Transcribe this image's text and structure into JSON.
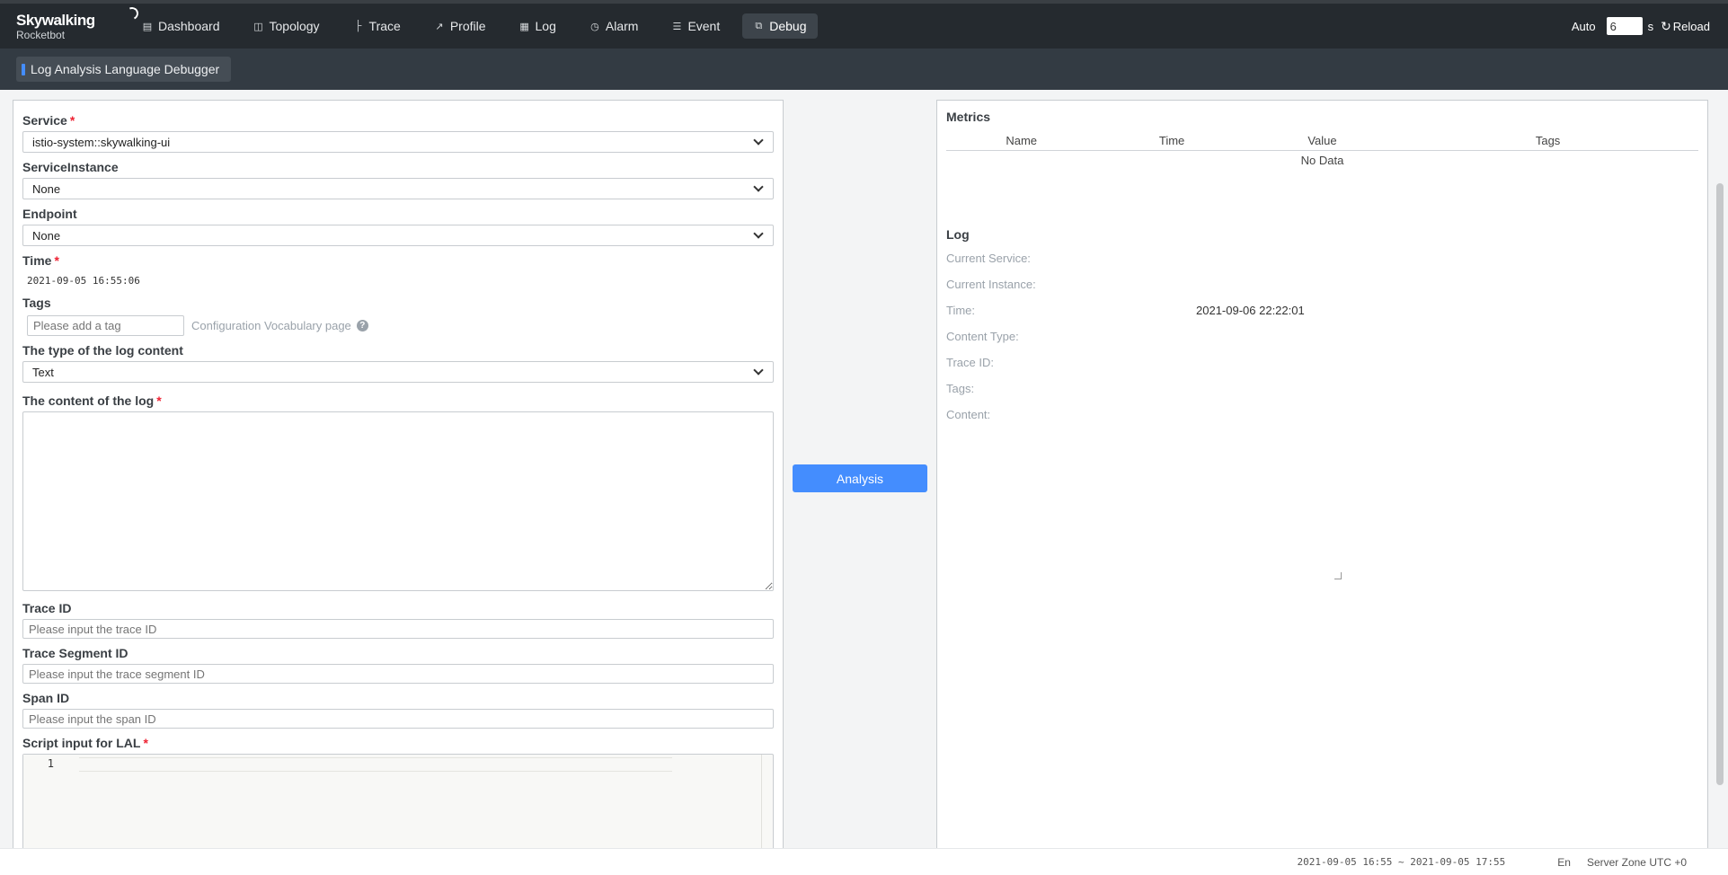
{
  "app": {
    "brand": "Skywalking",
    "sub": "Rocketbot"
  },
  "nav": {
    "items": [
      {
        "label": "Dashboard",
        "icon": "bar-chart-icon"
      },
      {
        "label": "Topology",
        "icon": "topology-icon"
      },
      {
        "label": "Trace",
        "icon": "trace-icon"
      },
      {
        "label": "Profile",
        "icon": "profile-icon"
      },
      {
        "label": "Log",
        "icon": "log-icon"
      },
      {
        "label": "Alarm",
        "icon": "alarm-icon"
      },
      {
        "label": "Event",
        "icon": "event-icon"
      },
      {
        "label": "Debug",
        "icon": "debug-icon",
        "active": true
      }
    ]
  },
  "topright": {
    "auto_label": "Auto",
    "interval_value": "6",
    "unit": "s",
    "reload_label": "Reload"
  },
  "page": {
    "tab_label": "Log Analysis Language Debugger"
  },
  "form": {
    "service_label": "Service",
    "service_value": "istio-system::skywalking-ui",
    "instance_label": "ServiceInstance",
    "instance_value": "None",
    "endpoint_label": "Endpoint",
    "endpoint_value": "None",
    "time_label": "Time",
    "time_value": "2021-09-05 16:55:06",
    "tags_label": "Tags",
    "tags_placeholder": "Please add a tag",
    "tags_link": "Configuration Vocabulary page",
    "content_type_label": "The type of the log content",
    "content_type_value": "Text",
    "content_label": "The content of the log",
    "trace_id_label": "Trace ID",
    "trace_id_placeholder": "Please input the trace ID",
    "segment_id_label": "Trace Segment ID",
    "segment_id_placeholder": "Please input the trace segment ID",
    "span_id_label": "Span ID",
    "span_id_placeholder": "Please input the span ID",
    "script_label": "Script input for LAL",
    "script_line_number": "1"
  },
  "actions": {
    "analysis_label": "Analysis"
  },
  "metrics": {
    "title": "Metrics",
    "columns": [
      "Name",
      "Time",
      "Value",
      "Tags"
    ],
    "empty": "No Data"
  },
  "log": {
    "title": "Log",
    "rows": [
      {
        "key": "Current Service:",
        "value": ""
      },
      {
        "key": "Current Instance:",
        "value": ""
      },
      {
        "key": "Time:",
        "value": "2021-09-06 22:22:01"
      },
      {
        "key": "Content Type:",
        "value": ""
      },
      {
        "key": "Trace ID:",
        "value": ""
      },
      {
        "key": "Tags:",
        "value": ""
      },
      {
        "key": "Content:",
        "value": ""
      }
    ]
  },
  "footer": {
    "range": "2021-09-05 16:55 ~ 2021-09-05 17:55",
    "lang": "En",
    "zone": "Server Zone UTC +0"
  },
  "colors": {
    "topbar": "#252a2f",
    "subbar": "#333b43",
    "accent": "#448dfe",
    "required": "#ee2233"
  }
}
